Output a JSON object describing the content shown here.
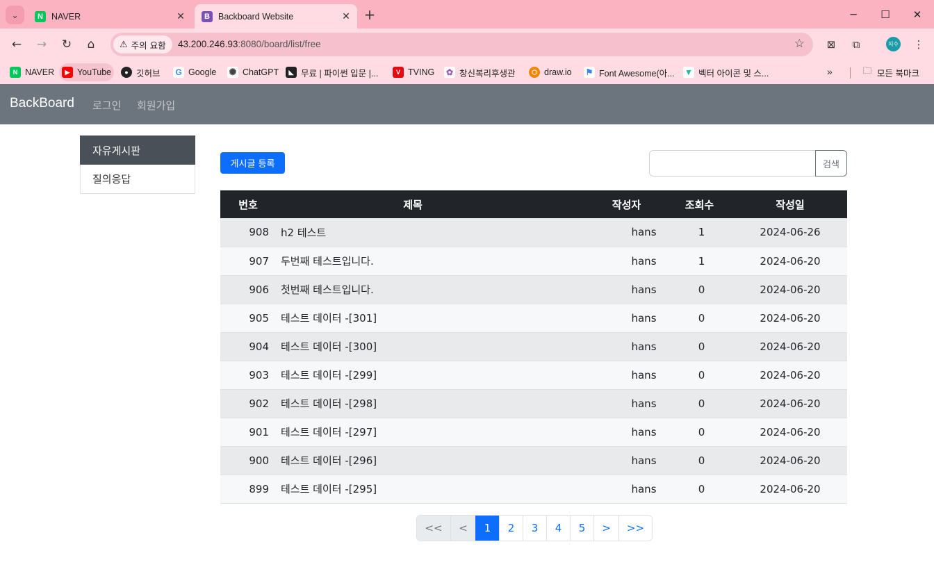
{
  "browser": {
    "tabs": [
      {
        "title": "NAVER",
        "icon": "naver-icon",
        "color": "#03c75a",
        "glyph": "N"
      },
      {
        "title": "Backboard Website",
        "icon": "bootstrap-icon",
        "color": "#7952b3",
        "glyph": "B"
      }
    ],
    "security_label": "주의 요함",
    "url_host": "43.200.246.93",
    "url_rest": ":8080/board/list/free",
    "profile_label": "지수",
    "bookmarks": [
      {
        "label": "NAVER",
        "icon": "naver-icon",
        "color": "#03c75a",
        "glyph": "N"
      },
      {
        "label": "YouTube",
        "icon": "youtube-icon",
        "color": "#ff0000",
        "glyph": "▶"
      },
      {
        "label": "깃허브",
        "icon": "github-icon",
        "color": "#222222",
        "glyph": "●"
      },
      {
        "label": "Google",
        "icon": "google-icon",
        "color": "#4285f4",
        "glyph": "G"
      },
      {
        "label": "ChatGPT",
        "icon": "chatgpt-icon",
        "color": "#555555",
        "glyph": "✺"
      },
      {
        "label": "무료 | 파이썬 입문 |...",
        "icon": "inflearn-icon",
        "color": "#222222",
        "glyph": "◣"
      },
      {
        "label": "TVING",
        "icon": "tving-icon",
        "color": "#e50914",
        "glyph": "V"
      },
      {
        "label": "창신복리후생관",
        "icon": "welfare-icon",
        "color": "#9b59b6",
        "glyph": "✿"
      },
      {
        "label": "draw.io",
        "icon": "drawio-icon",
        "color": "#f08705",
        "glyph": "⬡"
      },
      {
        "label": "Font Awesome(아...",
        "icon": "fontawesome-icon",
        "color": "#3b82f6",
        "glyph": "⚑"
      },
      {
        "label": "벡터 아이콘 및 스...",
        "icon": "flaticon-icon",
        "color": "#1abc9c",
        "glyph": "▼"
      }
    ],
    "all_bookmarks": "모든 북마크"
  },
  "navbar": {
    "brand": "BackBoard",
    "links": [
      "로그인",
      "회원가입"
    ]
  },
  "sidebar": {
    "items": [
      {
        "label": "자유게시판",
        "active": true
      },
      {
        "label": "질의응답",
        "active": false
      }
    ]
  },
  "actions": {
    "write_label": "게시글 등록",
    "search_placeholder": "",
    "search_label": "검색"
  },
  "table": {
    "headers": [
      "번호",
      "제목",
      "작성자",
      "조회수",
      "작성일"
    ],
    "rows": [
      [
        "908",
        "h2 테스트",
        "hans",
        "1",
        "2024-06-26"
      ],
      [
        "907",
        "두번째 테스트입니다.",
        "hans",
        "1",
        "2024-06-20"
      ],
      [
        "906",
        "첫번째 테스트입니다.",
        "hans",
        "0",
        "2024-06-20"
      ],
      [
        "905",
        "테스트 데이터 -[301]",
        "hans",
        "0",
        "2024-06-20"
      ],
      [
        "904",
        "테스트 데이터 -[300]",
        "hans",
        "0",
        "2024-06-20"
      ],
      [
        "903",
        "테스트 데이터 -[299]",
        "hans",
        "0",
        "2024-06-20"
      ],
      [
        "902",
        "테스트 데이터 -[298]",
        "hans",
        "0",
        "2024-06-20"
      ],
      [
        "901",
        "테스트 데이터 -[297]",
        "hans",
        "0",
        "2024-06-20"
      ],
      [
        "900",
        "테스트 데이터 -[296]",
        "hans",
        "0",
        "2024-06-20"
      ],
      [
        "899",
        "테스트 데이터 -[295]",
        "hans",
        "0",
        "2024-06-20"
      ]
    ]
  },
  "pagination": {
    "items": [
      {
        "label": "<<",
        "state": "disabled",
        "name": "page-first"
      },
      {
        "label": "<",
        "state": "disabled",
        "name": "page-prev"
      },
      {
        "label": "1",
        "state": "active",
        "name": "page-1"
      },
      {
        "label": "2",
        "state": "normal",
        "name": "page-2"
      },
      {
        "label": "3",
        "state": "normal",
        "name": "page-3"
      },
      {
        "label": "4",
        "state": "normal",
        "name": "page-4"
      },
      {
        "label": "5",
        "state": "normal",
        "name": "page-5"
      },
      {
        "label": ">",
        "state": "normal",
        "name": "page-next"
      },
      {
        "label": ">>",
        "state": "normal",
        "name": "page-last"
      }
    ]
  }
}
